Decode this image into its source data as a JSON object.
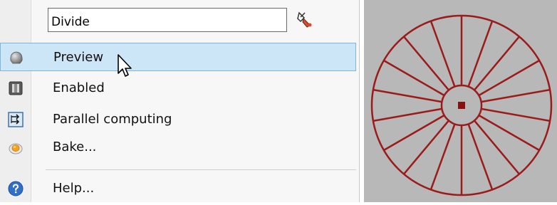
{
  "menu": {
    "name_field": {
      "value": "Divide"
    },
    "items": [
      {
        "label": "Preview",
        "icon": "preview-icon",
        "hover": true
      },
      {
        "label": "Enabled",
        "icon": "enabled-icon"
      },
      {
        "label": "Parallel computing",
        "icon": "parallel-computing-icon"
      },
      {
        "label": "Bake...",
        "icon": "bake-icon"
      },
      {
        "label": "Help...",
        "icon": "help-icon"
      }
    ]
  },
  "viewport": {
    "shape": "divided-circle",
    "segments": 18,
    "line_color": "#9b1b1b",
    "background": "#b8b8b8"
  },
  "colors": {
    "hover_fill": "#cde6f7",
    "hover_border": "#7fb4df",
    "help_blue": "#2f6fc9"
  }
}
